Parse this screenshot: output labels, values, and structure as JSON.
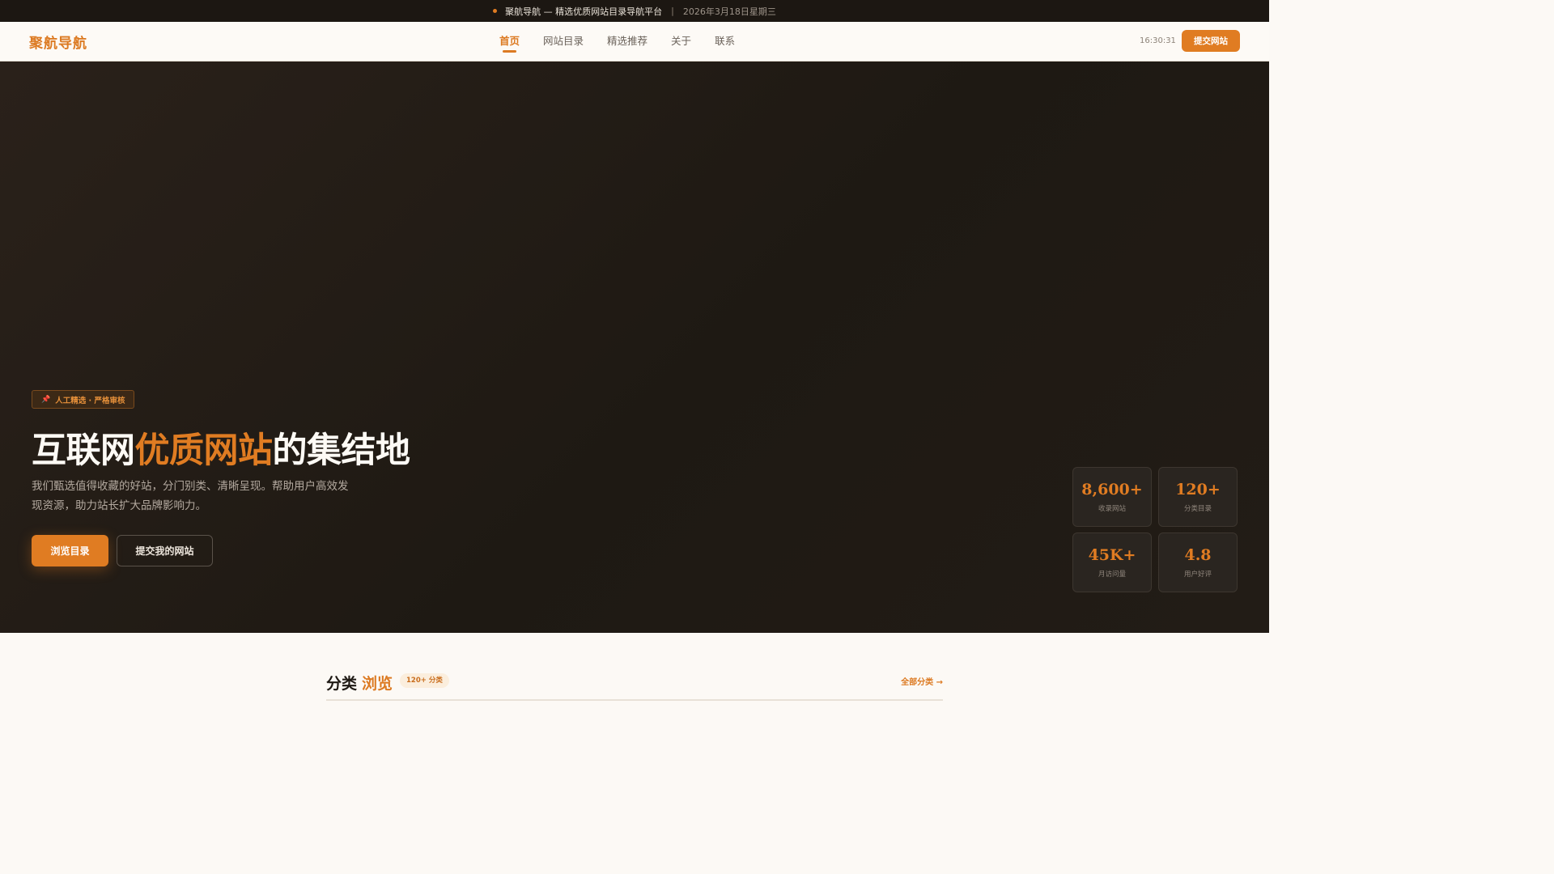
{
  "topbar": {
    "announcement": "聚航导航 — 精选优质网站目录导航平台",
    "separator": "|",
    "date": "2026年3月18日星期三"
  },
  "navbar": {
    "logo": "聚航导航",
    "items": [
      {
        "label": "首页",
        "active": true
      },
      {
        "label": "网站目录",
        "active": false
      },
      {
        "label": "精选推荐",
        "active": false
      },
      {
        "label": "关于",
        "active": false
      },
      {
        "label": "联系",
        "active": false
      }
    ],
    "clock": "16:30:31",
    "submit_label": "提交网站"
  },
  "hero": {
    "badge_icon": "pushpin-icon",
    "badge": "人工精选 · 严格审核",
    "title_pre": "互联网",
    "title_highlight": "优质网站",
    "title_post": "的集结地",
    "description": "我们甄选值得收藏的好站，分门别类、清晰呈现。帮助用户高效发现资源，助力站长扩大品牌影响力。",
    "primary_button": "浏览目录",
    "secondary_button": "提交我的网站",
    "stats": [
      {
        "value": "8,600+",
        "label": "收录网站"
      },
      {
        "value": "120+",
        "label": "分类目录"
      },
      {
        "value": "45K+",
        "label": "月访问量"
      },
      {
        "value": "4.8",
        "label": "用户好评"
      }
    ]
  },
  "categories": {
    "title": "分类",
    "title_highlight": "浏览",
    "count_badge": "120+ 分类",
    "all_link": "全部分类 →"
  },
  "colors": {
    "accent": "#e07c22",
    "dark_bg": "#1e1913",
    "page_bg": "#fcf9f5"
  }
}
